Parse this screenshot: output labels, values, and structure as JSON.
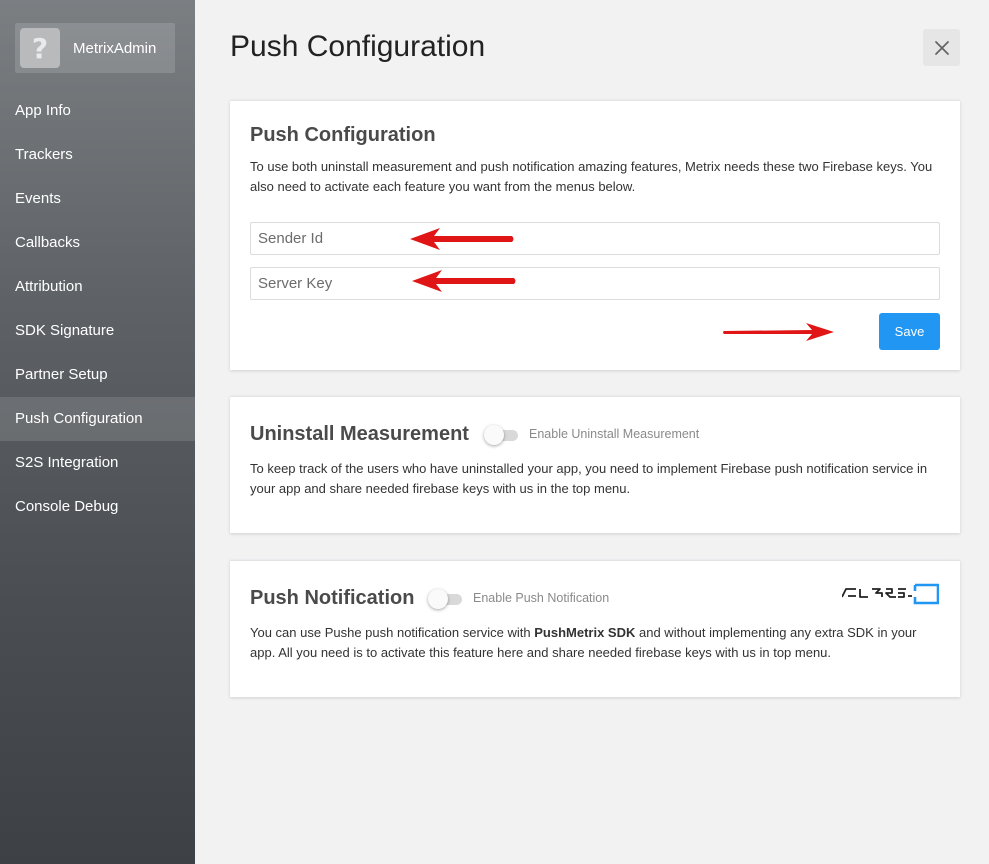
{
  "sidebar": {
    "app_name": "MetrixAdmin",
    "avatar_glyph": "?",
    "items": [
      {
        "label": "App Info"
      },
      {
        "label": "Trackers"
      },
      {
        "label": "Events"
      },
      {
        "label": "Callbacks"
      },
      {
        "label": "Attribution"
      },
      {
        "label": "SDK Signature"
      },
      {
        "label": "Partner Setup"
      },
      {
        "label": "Push Configuration",
        "active": true
      },
      {
        "label": "S2S Integration"
      },
      {
        "label": "Console Debug"
      }
    ]
  },
  "header": {
    "title": "Push Configuration",
    "close_icon": "close-icon"
  },
  "push_config": {
    "title": "Push Configuration",
    "description": "To use both uninstall measurement and push notification amazing features, Metrix needs these two Firebase keys. You also need to activate each feature you want from the menus below.",
    "sender_id": {
      "placeholder": "Sender Id",
      "value": ""
    },
    "server_key": {
      "placeholder": "Server Key",
      "value": ""
    },
    "save_label": "Save"
  },
  "uninstall": {
    "title": "Uninstall Measurement",
    "toggle_label": "Enable Uninstall Measurement",
    "enabled": false,
    "description": "To keep track of the users who have uninstalled your app, you need to implement Firebase push notification service in your app and share needed firebase keys with us in the top menu."
  },
  "push_notification": {
    "title": "Push Notification",
    "toggle_label": "Enable Push Notification",
    "enabled": false,
    "description_before": "You can use Pushe push notification service with ",
    "description_bold": "PushMetrix SDK",
    "description_after": " and without implementing any extra SDK in your app. All you need is to activate this feature here and share needed firebase keys with us in top menu.",
    "logo_icon": "pushe-logo-icon"
  },
  "colors": {
    "accent": "#2196f3",
    "annotation_arrow": "#e01515"
  }
}
